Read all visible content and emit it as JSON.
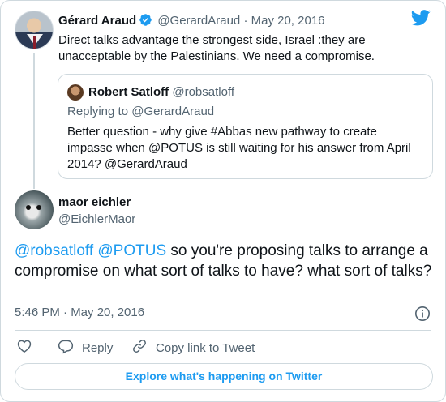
{
  "colors": {
    "accent": "#1d9bf0",
    "text": "#0f1419",
    "muted": "#536471",
    "border": "#cfd9de"
  },
  "parent_tweet": {
    "author_name": "Gérard Araud",
    "handle": "@GerardAraud",
    "date": "May 20, 2016",
    "text": "Direct talks advantage the strongest side, Israel :they are unacceptable by the Palestinians.  We need a compromise.",
    "verified_icon": "verified-badge-icon"
  },
  "quoted_tweet": {
    "author_name": "Robert Satloff",
    "handle": "@robsatloff",
    "replying_to": "Replying to @GerardAraud",
    "text": "Better question - why give #Abbas new pathway to create impasse when @POTUS is still waiting for his answer from April 2014? @GerardAraud"
  },
  "main_tweet": {
    "author_name": "maor eichler",
    "handle": "@EichlerMaor",
    "mention1": "@robsatloff",
    "mention2": "@POTUS",
    "text_rest": " so you're proposing talks to arrange a compromise on what sort of talks to have? what sort of talks?",
    "time": "5:46 PM · May 20, 2016"
  },
  "actions": {
    "like_icon": "heart-icon",
    "reply_label": "Reply",
    "copy_label": "Copy link to Tweet"
  },
  "explore_label": "Explore what's happening on Twitter"
}
